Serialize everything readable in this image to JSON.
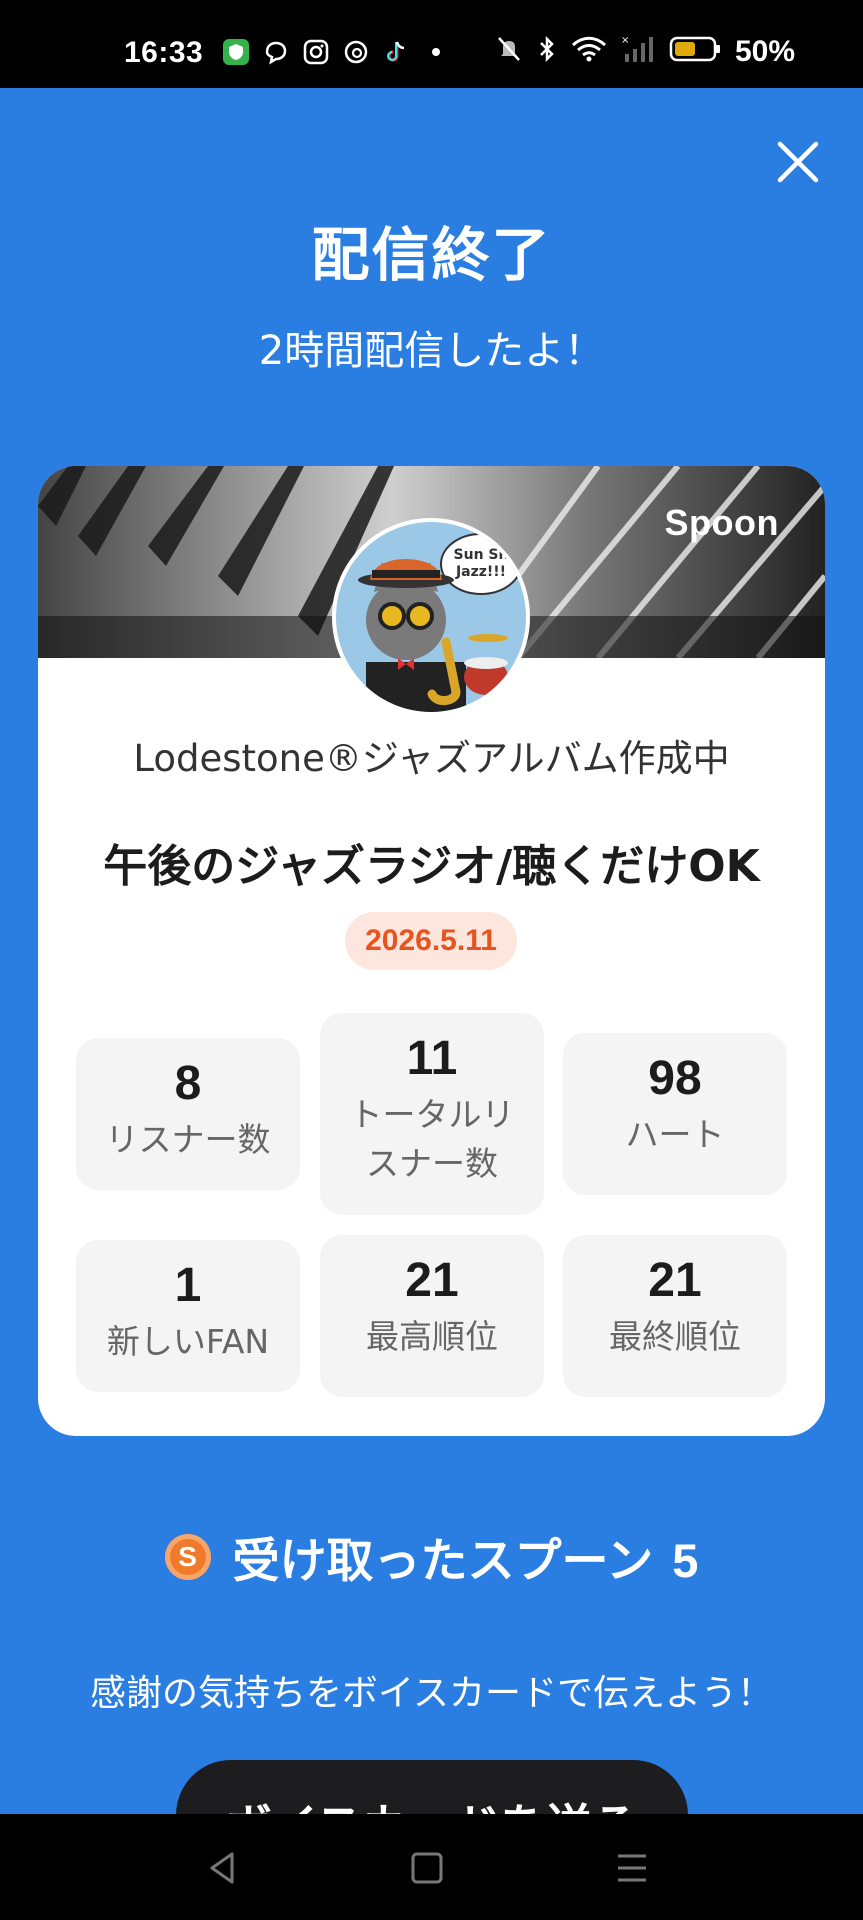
{
  "status_bar": {
    "time": "16:33",
    "battery_percent": "50%",
    "app_icons": [
      "shield-app-icon",
      "chat-app-icon",
      "instagram-icon",
      "threads-icon",
      "tiktok-icon"
    ],
    "indicator_icons": [
      "mute-icon",
      "bluetooth-icon",
      "wifi-icon",
      "signal-icon",
      "battery-icon"
    ]
  },
  "header": {
    "title": "配信終了",
    "subtitle": "2時間配信したよ！"
  },
  "card": {
    "brand": "Spoon",
    "avatar_caption": "Sun Sh\nJazz!!!",
    "username": "Lodestone®ジャズアルバム作成中",
    "live_title": "午後のジャズラジオ/聴くだけOK",
    "date": "2026.5.11",
    "stats": [
      {
        "value": "8",
        "label": "リスナー数"
      },
      {
        "value": "11",
        "label_line1": "トータルリ",
        "label_line2": "スナー数"
      },
      {
        "value": "98",
        "label": "ハート"
      },
      {
        "value": "1",
        "label": "新しいFAN"
      },
      {
        "value": "21",
        "label": "最高順位"
      },
      {
        "value": "21",
        "label": "最終順位"
      }
    ]
  },
  "spoons": {
    "coin_letter": "S",
    "label": "受け取ったスプーン",
    "count": "5"
  },
  "thanks_text": "感謝の気持ちをボイスカードで伝えよう！",
  "voice_card_button": "ボイスカードを送る",
  "colors": {
    "background": "#2a7de1",
    "date_text": "#e8531e",
    "date_bg": "#fde6dd",
    "coin": "#f07a2a"
  }
}
